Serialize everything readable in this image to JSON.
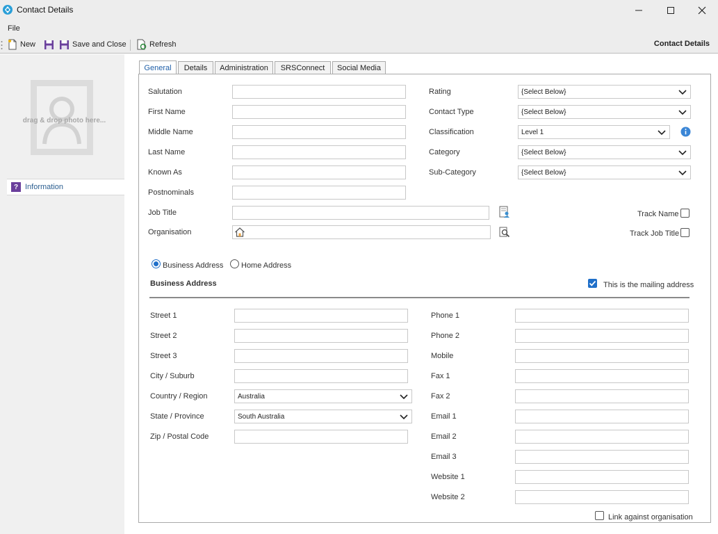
{
  "window": {
    "title": "Contact Details"
  },
  "menu": {
    "file": "File"
  },
  "toolbar": {
    "new": "New",
    "save_close": "Save and Close",
    "refresh": "Refresh",
    "header": "Contact Details"
  },
  "sidebar": {
    "photo_hint": "drag & drop photo here...",
    "info": "Information"
  },
  "tabs": [
    "General",
    "Details",
    "Administration",
    "SRSConnect",
    "Social Media"
  ],
  "general": {
    "salutation": "Salutation",
    "first_name": "First Name",
    "middle_name": "Middle Name",
    "last_name": "Last Name",
    "known_as": "Known As",
    "postnominals": "Postnominals",
    "job_title": "Job Title",
    "organisation": "Organisation",
    "rating": "Rating",
    "contact_type": "Contact Type",
    "classification": "Classification",
    "category": "Category",
    "sub_category": "Sub-Category",
    "rating_value": "{Select Below}",
    "contact_type_value": "{Select Below}",
    "classification_value": "Level 1",
    "category_value": "{Select Below}",
    "sub_category_value": "{Select Below}",
    "track_name": "Track Name",
    "track_job_title": "Track Job Title"
  },
  "address": {
    "business_radio": "Business Address",
    "home_radio": "Home Address",
    "heading": "Business Address",
    "mailing": "This is the mailing address",
    "street1": "Street 1",
    "street2": "Street 2",
    "street3": "Street 3",
    "city": "City / Suburb",
    "country": "Country / Region",
    "state": "State / Province",
    "zip": "Zip / Postal Code",
    "country_value": "Australia",
    "state_value": "South Australia",
    "phone1": "Phone 1",
    "phone2": "Phone 2",
    "mobile": "Mobile",
    "fax1": "Fax 1",
    "fax2": "Fax 2",
    "email1": "Email 1",
    "email2": "Email 2",
    "email3": "Email 3",
    "website1": "Website 1",
    "website2": "Website 2",
    "link_org": "Link against organisation"
  }
}
